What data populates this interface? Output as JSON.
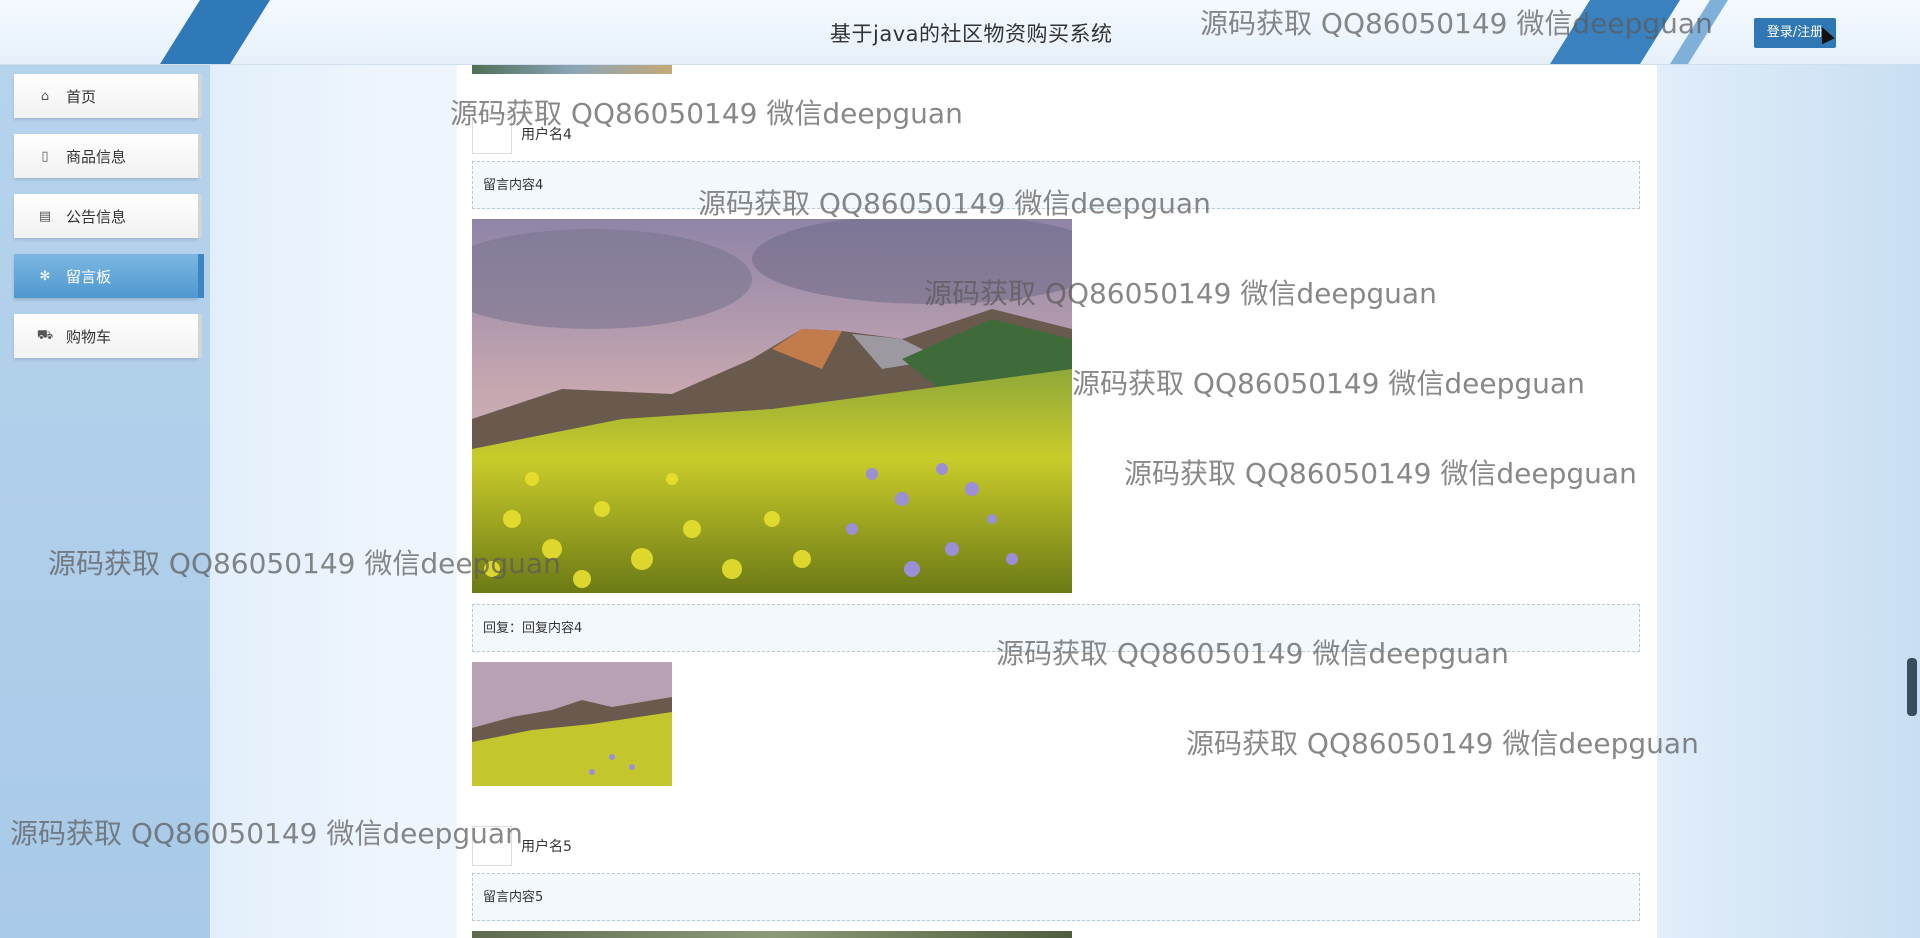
{
  "header": {
    "title": "基于java的社区物资购买系统",
    "login_label": "登录/注册"
  },
  "sidebar": {
    "items": [
      {
        "label": "首页",
        "icon": "home-icon",
        "glyph": "⌂",
        "active": false
      },
      {
        "label": "商品信息",
        "icon": "document-icon",
        "glyph": "▯",
        "active": false
      },
      {
        "label": "公告信息",
        "icon": "announcement-icon",
        "glyph": "▤",
        "active": false
      },
      {
        "label": "留言板",
        "icon": "message-board-icon",
        "glyph": "✻",
        "active": true
      },
      {
        "label": "购物车",
        "icon": "cart-icon",
        "glyph": "⛟",
        "active": false
      }
    ]
  },
  "messages": [
    {
      "username": "用户名4",
      "content": "留言内容4",
      "reply": "回复：回复内容4"
    },
    {
      "username": "用户名5",
      "content": "留言内容5"
    }
  ],
  "watermark": "源码获取 QQ86050149 微信deepguan",
  "colors": {
    "accent": "#2f78b5",
    "sidebar_bg": "#b6d3ec",
    "active_item": "#4f98d0"
  }
}
